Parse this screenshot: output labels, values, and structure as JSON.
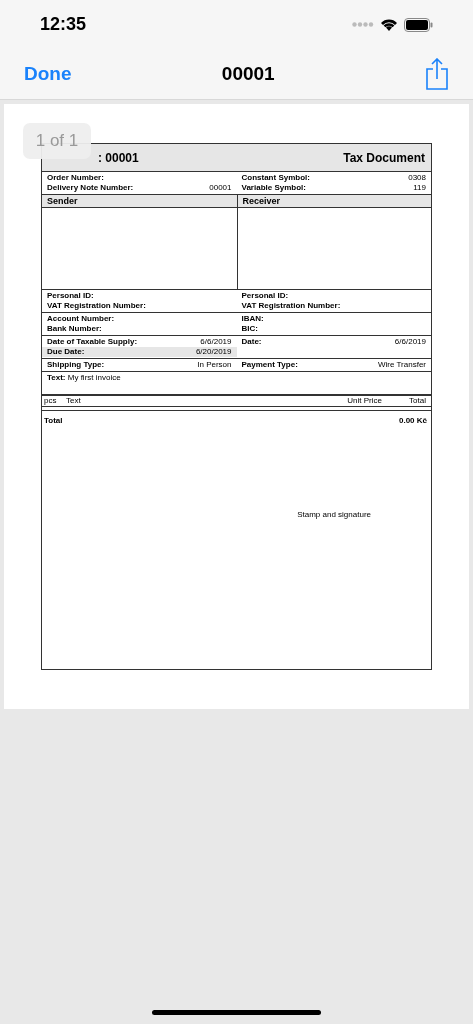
{
  "status_bar": {
    "time": "12:35"
  },
  "nav_bar": {
    "done": "Done",
    "title": "00001"
  },
  "page_badge": "1 of 1",
  "document": {
    "title_visible": ": 00001",
    "doc_type": "Tax Document",
    "sections": [
      {
        "left": [
          {
            "label": "Order Number:"
          },
          {
            "label": "Delivery Note Number:",
            "value": "00001"
          }
        ],
        "right": [
          {
            "label": "Constant Symbol:",
            "value": "0308"
          },
          {
            "label": "Variable Symbol:",
            "value": "119"
          }
        ]
      },
      {
        "kind": "parties",
        "left_heading": "Sender",
        "right_heading": "Receiver"
      },
      {
        "left": [
          {
            "label": "Personal ID:"
          },
          {
            "label": "VAT Registration Number:"
          }
        ],
        "right": [
          {
            "label": "Personal ID:"
          },
          {
            "label": "VAT Registration Number:"
          }
        ]
      },
      {
        "left": [
          {
            "label": "Account Number:"
          },
          {
            "label": "Bank Number:"
          }
        ],
        "right": [
          {
            "label": "IBAN:"
          },
          {
            "label": "BIC:"
          }
        ]
      },
      {
        "left": [
          {
            "label": "Date of Taxable Supply:",
            "value": "6/6/2019",
            "highlighted": false
          },
          {
            "label": "Due Date:",
            "value": "6/20/2019",
            "highlighted": true
          }
        ],
        "right": [
          {
            "label": "Date:",
            "value": "6/6/2019"
          }
        ]
      },
      {
        "left": [
          {
            "label": "Shipping Type:",
            "value": "In Person"
          }
        ],
        "right": [
          {
            "label": "Payment Type:",
            "value": "Wire Transfer"
          }
        ]
      }
    ],
    "note": "**Text:** My first invoice",
    "item_columns": [
      "pcs",
      "Text",
      "Unit Price",
      "Total"
    ],
    "total_label": "Total",
    "total_value": "0.00 Kč",
    "stamp": "Stamp and signature"
  }
}
